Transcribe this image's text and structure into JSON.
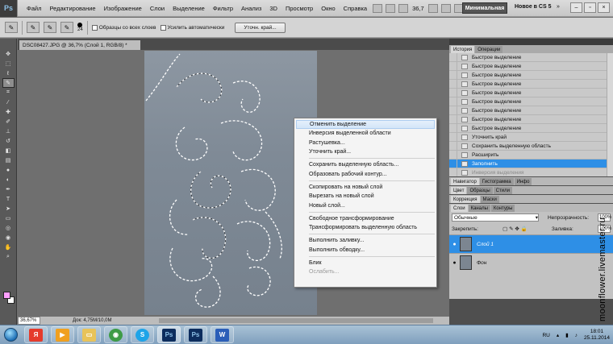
{
  "app": {
    "logo": "Ps",
    "menu": [
      "Файл",
      "Редактирование",
      "Изображение",
      "Слои",
      "Выделение",
      "Фильтр",
      "Анализ",
      "3D",
      "Просмотр",
      "Окно",
      "Справка"
    ],
    "zoom": "36,7",
    "workspace_button": "Минимальная",
    "workspace_new": "Новое в CS 5"
  },
  "options": {
    "brush_size": "24",
    "sample_all_layers": "Образцы со всех слоев",
    "auto_enhance": "Усилить автоматически",
    "refine_edge_button": "Уточн. край..."
  },
  "document": {
    "tab_title": "DSC08427.JPG @ 36,7% (Слой 1, RGB/8) *",
    "status_zoom": "36,67%",
    "status_doc": "Док: 4,75M/10,0M"
  },
  "context_menu": {
    "items": [
      "Отменить выделение",
      "Инверсия выделенной области",
      "Растушевка...",
      "Уточнить край...",
      "Сохранить выделенную область...",
      "Образовать рабочий контур...",
      "Скопировать на новый слой",
      "Вырезать на новый слой",
      "Новый слой...",
      "Свободное трансформирование",
      "Трансформировать выделенную область",
      "Выполнить заливку...",
      "Выполнить обводку...",
      "Блик",
      "Ослабить..."
    ]
  },
  "panels": {
    "history_tabs": [
      "История",
      "Операции"
    ],
    "history_items": [
      "Быстрое выделение",
      "Быстрое выделение",
      "Быстрое выделение",
      "Быстрое выделение",
      "Быстрое выделение",
      "Быстрое выделение",
      "Быстрое выделение",
      "Быстрое выделение",
      "Быстрое выделение",
      "Уточнить край",
      "Сохранить выделенную область",
      "Расширить",
      "Заполнить",
      "Инверсия выделения"
    ],
    "nav_tabs": [
      "Навигатор",
      "Гистограмма",
      "Инфо"
    ],
    "color_tabs": [
      "Цвет",
      "Образцы",
      "Стили"
    ],
    "correction_tabs": [
      "Коррекция",
      "Маски"
    ],
    "layers_tabs": [
      "Слои",
      "Каналы",
      "Контуры"
    ],
    "blend_mode": "Обычные",
    "opacity_label": "Непрозрачность:",
    "opacity_value": "100%",
    "lock_label": "Закрепить:",
    "fill_label": "Заливка:",
    "fill_value": "100%",
    "layers": [
      "Слой 1",
      "Фон"
    ]
  },
  "watermark": "moonflower.livemaster.ru",
  "taskbar": {
    "lang": "RU",
    "time": "18:01",
    "date": "25.11.2014"
  },
  "colors": {
    "foreground": "#ff9fff",
    "background": "#ffffff",
    "selection_blue": "#2e8fe6"
  }
}
